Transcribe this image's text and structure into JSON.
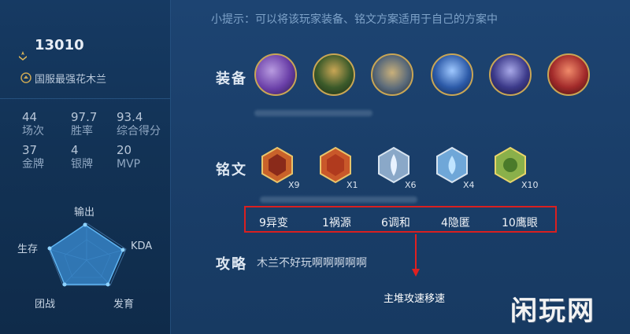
{
  "hint": "小提示：可以将该玩家装备、铭文方案适用于自己的方案中",
  "player": {
    "score": "13010",
    "title": "国服最强花木兰"
  },
  "stats": [
    {
      "value": "44",
      "label": "场次"
    },
    {
      "value": "97.7",
      "label": "胜率"
    },
    {
      "value": "93.4",
      "label": "综合得分"
    },
    {
      "value": "37",
      "label": "金牌"
    },
    {
      "value": "4",
      "label": "银牌"
    },
    {
      "value": "20",
      "label": "MVP"
    }
  ],
  "radar": {
    "labels": [
      "输出",
      "KDA",
      "发育",
      "团战",
      "生存"
    ]
  },
  "sections": {
    "equipment": "装备",
    "inscriptions": "铭文",
    "guide": "攻略"
  },
  "equipment": [
    {
      "icon": "axe-item-icon",
      "color": "#6a3fa8"
    },
    {
      "icon": "warrior-item-icon",
      "color": "#3b5a2a"
    },
    {
      "icon": "armor-item-icon",
      "color": "#5a6a7a"
    },
    {
      "icon": "spear-item-icon",
      "color": "#2c5aa8"
    },
    {
      "icon": "cloak-item-icon",
      "color": "#3c3a8a"
    },
    {
      "icon": "helmet-item-icon",
      "color": "#a22a2a"
    }
  ],
  "runes": [
    {
      "icon": "red-rune-icon",
      "count": "X9",
      "color": "#c9622a"
    },
    {
      "icon": "red-rune-icon",
      "count": "X1",
      "color": "#c9582a"
    },
    {
      "icon": "blue-rune-icon",
      "count": "X6",
      "color": "#8aa8c8"
    },
    {
      "icon": "blue-rune-icon",
      "count": "X4",
      "color": "#6fa7d8"
    },
    {
      "icon": "green-rune-icon",
      "count": "X10",
      "color": "#8ab04a"
    }
  ],
  "inscription_names": [
    "9异变",
    "1祸源",
    "6调和",
    "4隐匿",
    "10鹰眼"
  ],
  "guide_text": "木兰不好玩啊啊啊啊啊",
  "note": "主堆攻速移速",
  "watermark": "闲玩网"
}
